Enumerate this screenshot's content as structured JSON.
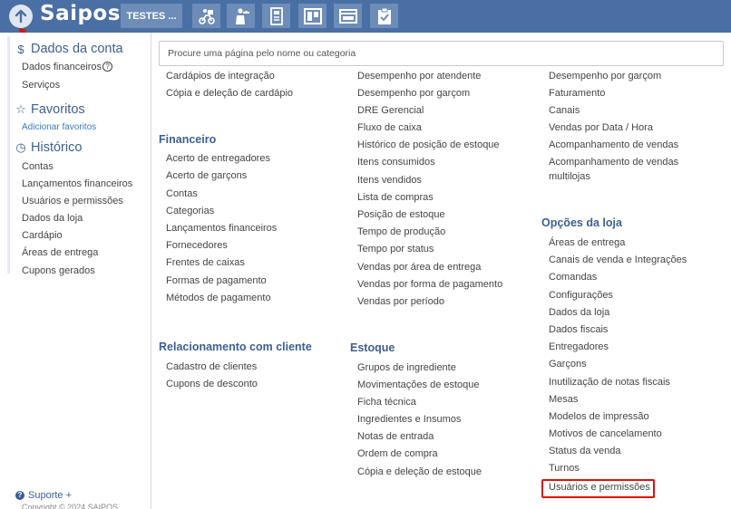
{
  "topbar": {
    "logo": "Saipos",
    "store_label": "TESTES ...",
    "icons": [
      "delivery-icon",
      "waiter-icon",
      "menu-card-icon",
      "kanban-icon",
      "cashier-icon",
      "checklist-icon"
    ],
    "bg_color": "#4a6fa5"
  },
  "sidebar": {
    "account": {
      "title": "Dados da conta",
      "items": [
        "Dados financeiros",
        "Serviços"
      ]
    },
    "favorites": {
      "title": "Favoritos",
      "add_link": "Adicionar favoritos"
    },
    "history": {
      "title": "Histórico",
      "items": [
        "Contas",
        "Lançamentos financeiros",
        "Usuários e permissões",
        "Dados da loja",
        "Cardápio",
        "Áreas de entrega",
        "Cupons gerados"
      ]
    },
    "support": "Suporte +",
    "copyright": "Copyright © 2024 SAIPOS"
  },
  "search": {
    "placeholder": "Procure uma página pelo nome ou categoria"
  },
  "columns": {
    "col1": {
      "top_items": [
        "Cardápios de integração",
        "Cópia e deleção de cardápio"
      ],
      "financeiro": {
        "title": "Financeiro",
        "items": [
          "Acerto de entregadores",
          "Acerto de garçons",
          "Contas",
          "Categorias",
          "Lançamentos financeiros",
          "Fornecedores",
          "Frentes de caixas",
          "Formas de pagamento",
          "Métodos de pagamento"
        ]
      },
      "relacionamento": {
        "title": "Relacionamento com cliente",
        "items": [
          "Cadastro de clientes",
          "Cupons de desconto"
        ]
      }
    },
    "col2": {
      "top_items": [
        "Desempenho por atendente",
        "Desempenho por garçom",
        "DRE Gerencial",
        "Fluxo de caixa",
        "Histórico de posição de estoque",
        "Itens consumidos",
        "Itens vendidos",
        "Lista de compras",
        "Posição de estoque",
        "Tempo de produção",
        "Tempo por status",
        "Vendas por área de entrega",
        "Vendas por forma de pagamento",
        "Vendas por período"
      ],
      "estoque": {
        "title": "Estoque",
        "items": [
          "Grupos de ingrediente",
          "Movimentações de estoque",
          "Ficha técnica",
          "Ingredientes e Insumos",
          "Notas de entrada",
          "Ordem de compra",
          "Cópia e deleção de estoque"
        ]
      }
    },
    "col3": {
      "top_items": [
        "Desempenho por garçom",
        "Faturamento",
        "Canais",
        "Vendas por Data / Hora",
        "Acompanhamento de vendas",
        "Acompanhamento de vendas",
        "multilojas"
      ],
      "opcoes": {
        "title": "Opções da loja",
        "items": [
          "Áreas de entrega",
          "Canais de venda e Integrações",
          "Comandas",
          "Configurações",
          "Dados da loja",
          "Dados fiscais",
          "Entregadores",
          "Garçons",
          "Inutilização de notas fiscais",
          "Mesas",
          "Modelos de impressão",
          "Motivos de cancelamento",
          "Status da venda",
          "Turnos",
          "Usuários e permissões"
        ]
      }
    }
  },
  "highlight_color": "#e01010"
}
